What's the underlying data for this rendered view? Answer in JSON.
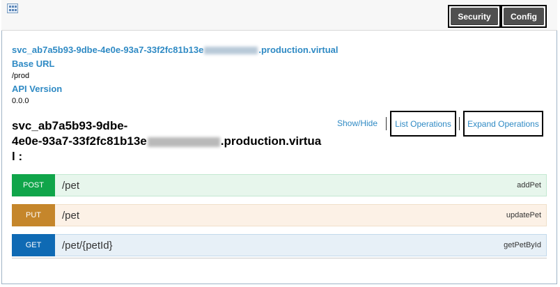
{
  "header": {
    "security_button": "Security",
    "config_button": "Config"
  },
  "info": {
    "host_prefix": "svc_ab7a5b93-9dbe-4e0e-93a7-33f2fc81b13e",
    "host_suffix": ".production.virtual",
    "base_url_label": "Base URL",
    "base_url_value": "/prod",
    "api_version_label": "API Version",
    "api_version_value": "0.0.0"
  },
  "resource": {
    "title_line1": "svc_ab7a5b93-9dbe-",
    "title_line2_prefix": "4e0e-93a7-33f2fc81b13e",
    "title_line2_suffix": ".production.virtua",
    "title_line3": "l :",
    "show_hide": "Show/Hide",
    "list_operations": "List Operations",
    "expand_operations": "Expand Operations"
  },
  "operations": [
    {
      "method": "POST",
      "path": "/pet",
      "operation_id": "addPet",
      "color": "#10a54a",
      "bg": "#e7f6ec",
      "border": "#c3e8d1"
    },
    {
      "method": "PUT",
      "path": "/pet",
      "operation_id": "updatePet",
      "color": "#c5862b",
      "bg": "#fcf1e6",
      "border": "#f0e0ca"
    },
    {
      "method": "GET",
      "path": "/pet/{petId}",
      "operation_id": "getPetById",
      "color": "#0f6ab4",
      "bg": "#e7f0f7",
      "border": "#c3d9ec"
    }
  ]
}
